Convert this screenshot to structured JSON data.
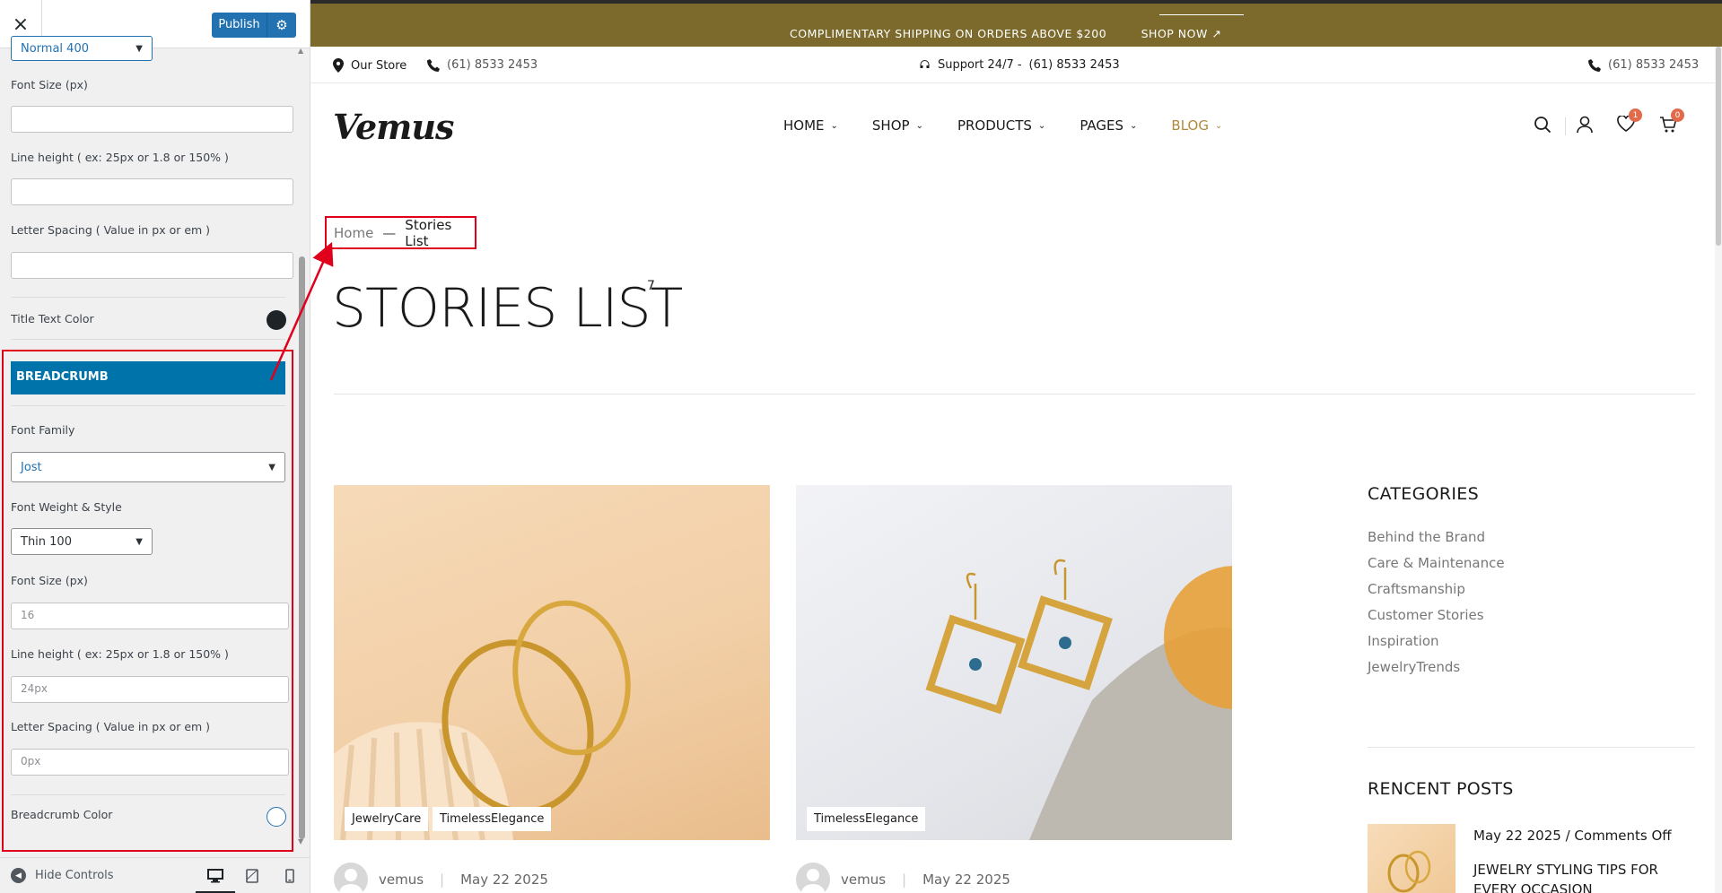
{
  "customizer": {
    "close_label": "×",
    "publish_label": "Publish",
    "top_select_value": "Normal 400",
    "title_section": {
      "font_size_label": "Font Size (px)",
      "line_height_label": "Line height ( ex: 25px or 1.8 or 150% )",
      "letter_spacing_label": "Letter Spacing ( Value in px or em )",
      "title_color_label": "Title Text Color",
      "title_color": "#1d2327"
    },
    "breadcrumb_section": {
      "header": "BREADCRUMB",
      "font_family_label": "Font Family",
      "font_family_value": "Jost",
      "font_weight_label": "Font Weight & Style",
      "font_weight_value": "Thin 100",
      "font_size_label": "Font Size (px)",
      "font_size_value": "16",
      "line_height_label": "Line height ( ex: 25px or 1.8 or 150% )",
      "line_height_value": "24px",
      "letter_spacing_label": "Letter Spacing ( Value in px or em )",
      "letter_spacing_value": "0px",
      "color_label": "Breadcrumb Color",
      "color": "#ffffff"
    },
    "footer": {
      "hide_controls_label": "Hide Controls"
    },
    "accent_color": "#2271b1",
    "highlight_color": "#e0001b"
  },
  "site": {
    "topbar_message": "COMPLIMENTARY SHIPPING ON ORDERS ABOVE $200",
    "topbar_link": "SHOP NOW ↗",
    "info": {
      "store": "Our Store",
      "phone_left": "(61) 8533 2453",
      "support_label": "Support 24/7 -",
      "support_phone": "(61) 8533 2453",
      "phone_right": "(61) 8533 2453"
    },
    "logo": "Vemus",
    "nav": [
      {
        "label": "HOME"
      },
      {
        "label": "SHOP"
      },
      {
        "label": "PRODUCTS"
      },
      {
        "label": "PAGES"
      },
      {
        "label": "BLOG"
      }
    ],
    "wishlist_count": "1",
    "cart_count": "0",
    "breadcrumb": {
      "home": "Home",
      "separator": "—",
      "current": "Stories List"
    },
    "page_title": "STORIES LIST",
    "title_count": "7",
    "posts": [
      {
        "tags": [
          "JewelryCare",
          "TimelessElegance"
        ],
        "author": "vemus",
        "date": "May 22 2025"
      },
      {
        "tags": [
          "TimelessElegance"
        ],
        "author": "vemus",
        "date": "May 22 2025"
      }
    ],
    "categories_title": "CATEGORIES",
    "categories": [
      "Behind the Brand",
      "Care & Maintenance",
      "Craftsmanship",
      "Customer Stories",
      "Inspiration",
      "JewelryTrends"
    ],
    "recent_title": "RENCENT POSTS",
    "recent_post": {
      "date": "May 22 2025",
      "comments": "/ Comments Off",
      "title": "JEWELRY STYLING TIPS FOR EVERY OCCASION"
    },
    "accent_gold": "#b08a3e",
    "topbar_color": "#7b6a2b"
  }
}
